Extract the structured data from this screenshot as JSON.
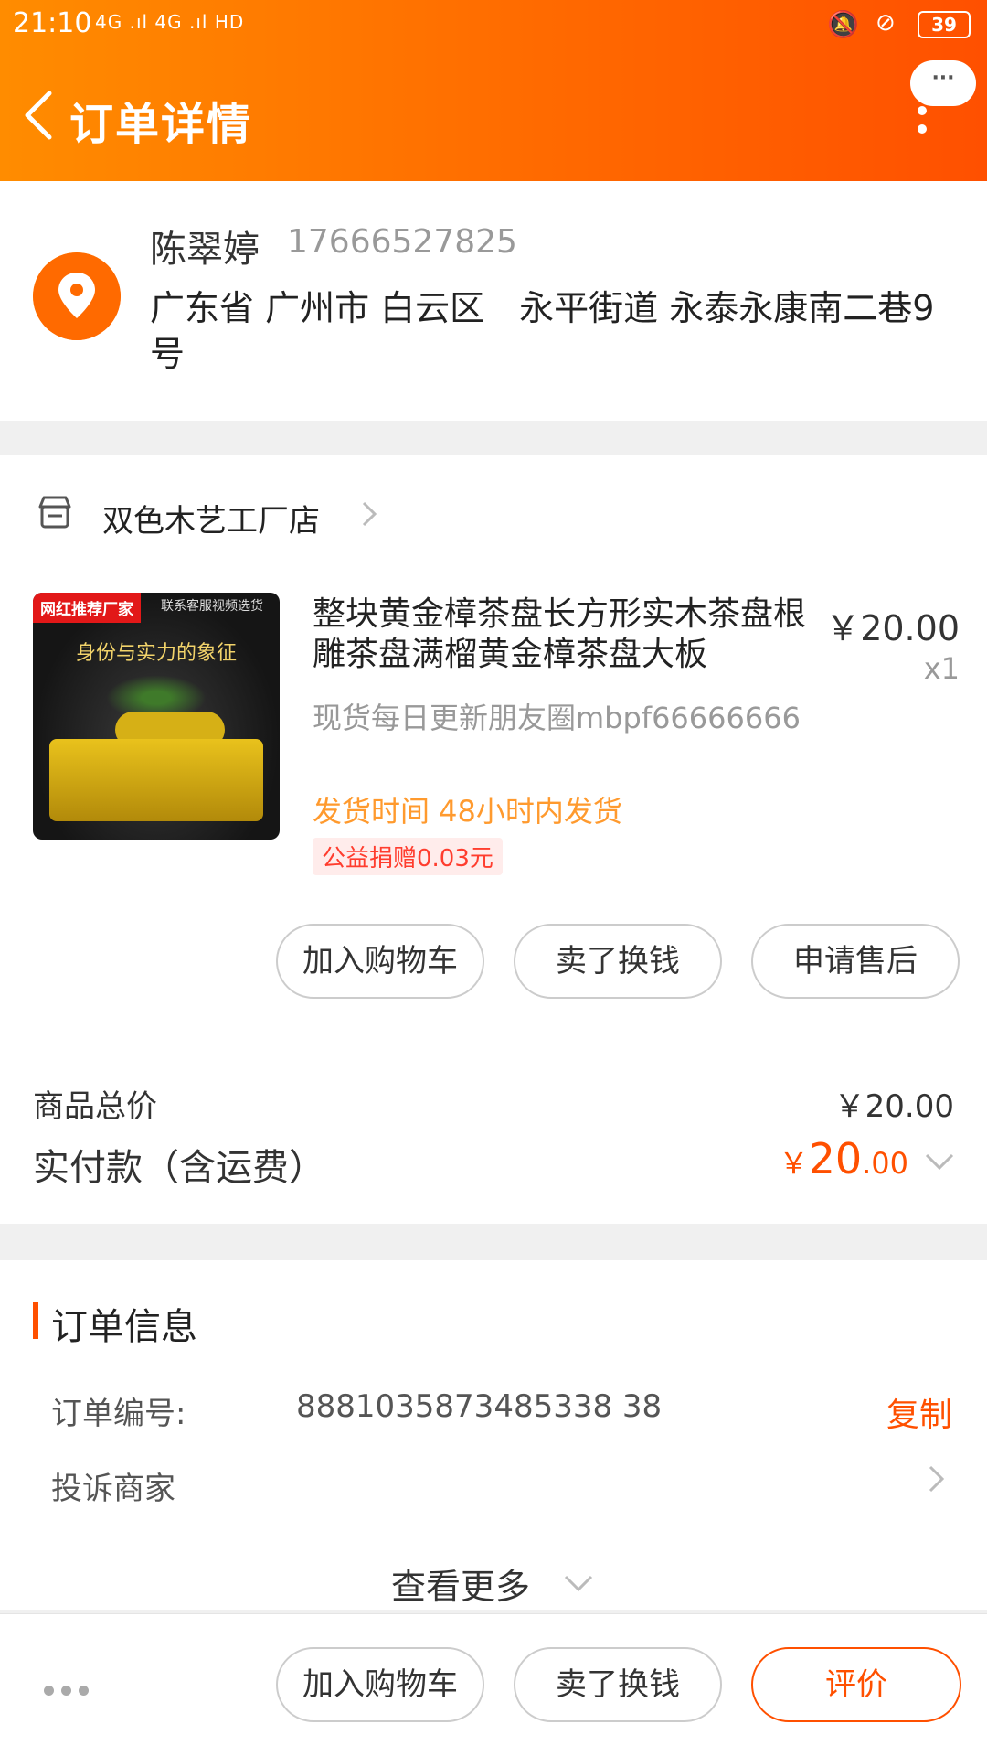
{
  "status_bar": {
    "time": "21:10",
    "signal": "4G .ıl 4G .ıl HD",
    "battery": "39"
  },
  "header": {
    "title": "订单详情",
    "more_label": "···"
  },
  "address": {
    "name": "陈翠婷",
    "phone": "17666527825",
    "text": "广东省 广州市 白云区　永平街道 永泰永康南二巷9号"
  },
  "shop": {
    "name": "双色木艺工厂店"
  },
  "product": {
    "image_tag": "网红推荐厂家",
    "image_tag2": "联系客服视频选货",
    "image_caption": "身份与实力的象征",
    "title": "整块黄金樟茶盘长方形实木茶盘根雕茶盘满榴黄金樟茶盘大板",
    "price": "￥20.00",
    "qty": "x1",
    "spec": "现货每日更新朋友圈mbpf66666666",
    "ship": "发货时间  48小时内发货",
    "donate": "公益捐赠0.03元"
  },
  "item_actions": {
    "add_cart": "加入购物车",
    "resell": "卖了换钱",
    "after_sale": "申请售后"
  },
  "totals": {
    "goods_label": "商品总价",
    "goods_value": "￥20.00",
    "paid_label": "实付款（含运费）",
    "paid_symbol": "￥",
    "paid_int": "20",
    "paid_dec": ".00"
  },
  "order_info": {
    "title": "订单信息",
    "number_label": "订单编号:",
    "number_value": "8881035873485338 38",
    "copy": "复制",
    "complain": "投诉商家",
    "see_more": "查看更多"
  },
  "bottom_bar": {
    "add_cart": "加入购物车",
    "resell": "卖了换钱",
    "rate": "评价"
  },
  "colors": {
    "accent": "#ff5000",
    "header_start": "#ff8c00",
    "ship_text": "#ff9a2e"
  }
}
